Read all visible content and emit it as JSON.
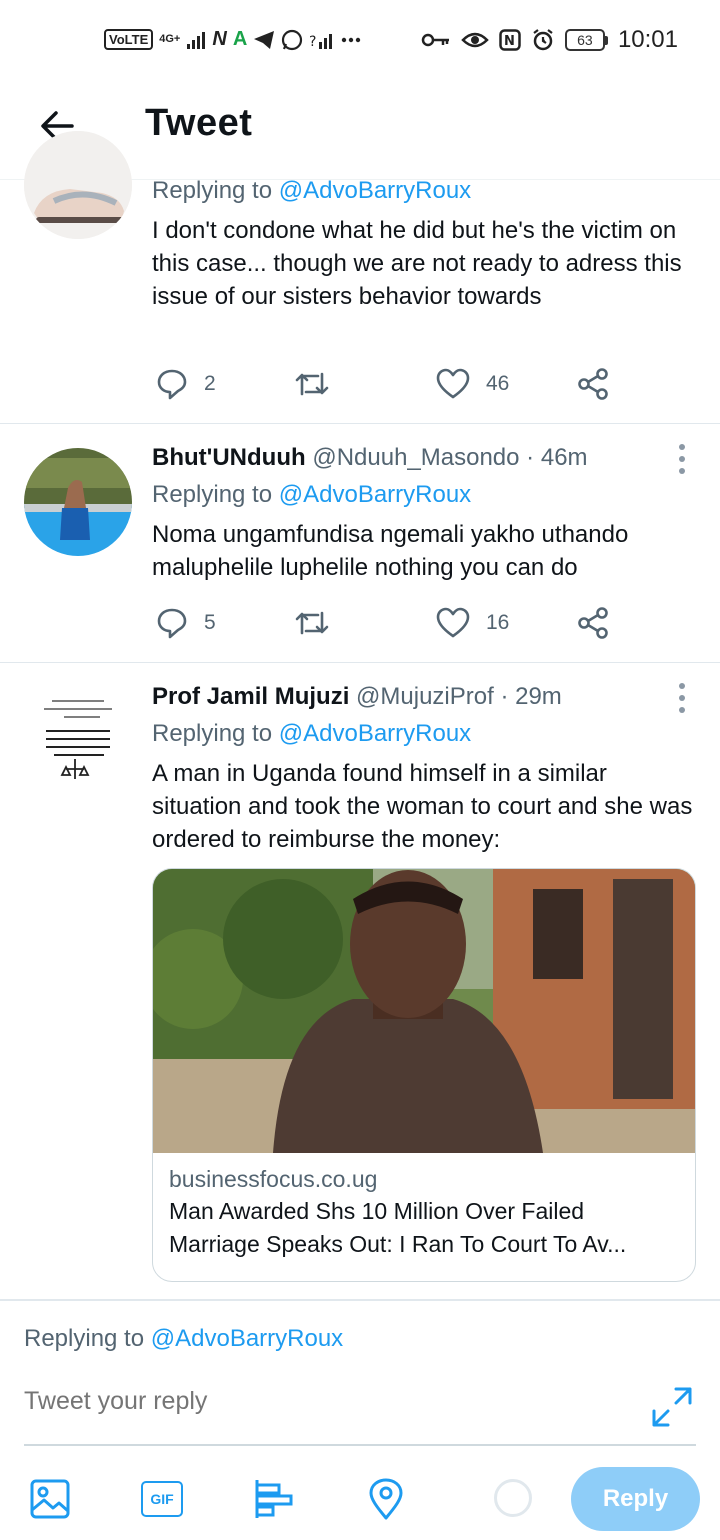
{
  "status_bar": {
    "volte": "VoLTE",
    "network": "4G+",
    "right_n": "N",
    "battery": "63",
    "time": "10:01"
  },
  "header": {
    "title": "Tweet"
  },
  "tweets": [
    {
      "replying_prefix": "Replying to ",
      "replying_to": "@AdvoBarryRoux",
      "text": "I don't condone what he did but he's the victim on this case... though we are not ready to adress this issue of our sisters behavior towards",
      "replies": "2",
      "likes": "46"
    },
    {
      "name": "Bhut'UNduuh",
      "handle": "@Nduuh_Masondo",
      "dot": "·",
      "time": "46m",
      "replying_prefix": "Replying to ",
      "replying_to": "@AdvoBarryRoux",
      "text": "Noma ungamfundisa ngemali yakho uthando maluphelile luphelile nothing you can do",
      "replies": "5",
      "likes": "16"
    },
    {
      "name": "Prof Jamil Mujuzi",
      "handle": "@MujuziProf",
      "dot": "·",
      "time": "29m",
      "replying_prefix": "Replying to ",
      "replying_to": "@AdvoBarryRoux",
      "text": "A man in Uganda found himself in a similar situation and took the woman to court and she was ordered to reimburse the money:",
      "avatar_lines": [
        "Allāh ﷻ says:",
        "\"And do not let the hatred of a people prevent you from being just. Be just; that is nearer to piety.\""
      ],
      "card": {
        "domain": "businessfocus.co.ug",
        "title": "Man Awarded Shs 10 Million Over Failed Marriage Speaks Out: I Ran To Court To Av..."
      }
    }
  ],
  "composer": {
    "replying_prefix": "Replying to ",
    "replying_to": "@AdvoBarryRoux",
    "placeholder": "Tweet your reply",
    "gif_label": "GIF",
    "reply_label": "Reply"
  },
  "colors": {
    "accent": "#1d9bf0",
    "reply_button": "#8ecdf8",
    "text": "#0f1419",
    "secondary": "#536471",
    "divider": "#e1e8ed"
  }
}
